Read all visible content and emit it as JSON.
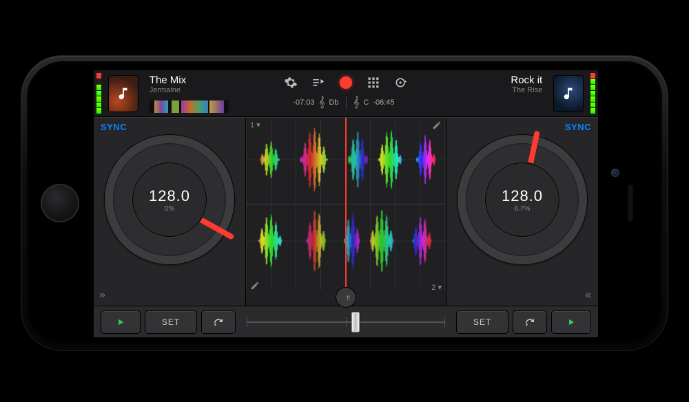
{
  "colors": {
    "accent": "#ff3b30",
    "sync": "#0a84ff",
    "play": "#30d158"
  },
  "deckA": {
    "track_title": "The Mix",
    "artist": "Jermaine",
    "time_remaining": "-07:03",
    "key": "Db",
    "bpm": "128.0",
    "pitch_pct": "0%",
    "sync_label": "SYNC",
    "needle_deg": 29,
    "cue_set_label": "SET",
    "lane_label": "1 ▾",
    "expand_glyph": "»"
  },
  "deckB": {
    "track_title": "Rock it",
    "artist": "The Rise",
    "time_remaining": "-06:45",
    "key": "C",
    "bpm": "128.0",
    "pitch_pct": "6.7%",
    "sync_label": "SYNC",
    "needle_deg": -78,
    "cue_set_label": "SET",
    "lane_label": "2 ▾",
    "expand_glyph": "«"
  },
  "toolbar": {
    "icons": [
      "settings",
      "queue",
      "record",
      "sampler",
      "automix"
    ]
  },
  "crossfader": {
    "position_pct": 55
  },
  "icons": {
    "music_note": "music-note-icon",
    "gear": "gear-icon",
    "queue": "queue-playlist-icon",
    "record": "record-icon",
    "grid": "sampler-grid-icon",
    "automix": "automix-icon",
    "pencil": "pencil-icon",
    "crossfader": "crossfader-icon",
    "play": "play-icon",
    "cue_jump": "cue-jump-icon"
  }
}
